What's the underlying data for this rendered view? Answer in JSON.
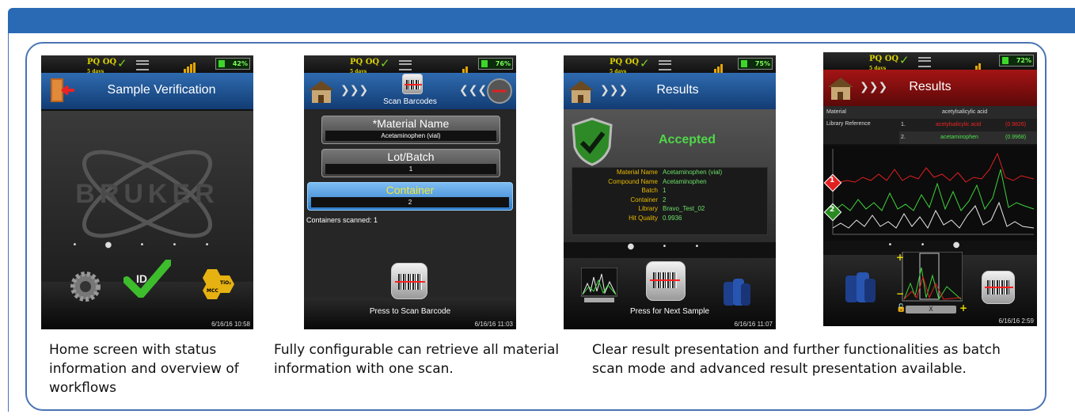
{
  "colors": {
    "header_blue": "#2a6ab5",
    "frame_border": "#4a74b4",
    "accent_green": "#6ce06a",
    "accent_yellow": "#e8b900",
    "results_red": "#a41414"
  },
  "screens": [
    {
      "id": "home",
      "battery": "42%",
      "title": "Sample Verification",
      "watermark": "BRUKER",
      "page_indicator": "• ● • • •",
      "bottom_icons": [
        "gear-icon",
        "id-check-icon",
        "tools-chemistry-icon"
      ],
      "id_text": "ID",
      "hex_text_1": "TiO₂",
      "hex_text_2": "MCC",
      "timestamp": "6/16/16 10:58"
    },
    {
      "id": "scan",
      "battery": "76%",
      "subtitle": "Scan Barcodes",
      "fields": [
        {
          "label": "*Material Name",
          "value": "Acetaminophen (vial)"
        },
        {
          "label": "Lot/Batch",
          "value": "1"
        },
        {
          "label": "Container",
          "value": "2"
        }
      ],
      "status": "Containers scanned: 1",
      "button_label": "Press to Scan Barcode",
      "timestamp": "6/16/16 11:03"
    },
    {
      "id": "results",
      "battery": "75%",
      "title": "Results",
      "verdict": "Accepted",
      "rows": [
        {
          "k": "Material Name",
          "v": "Acetaminophen (vial)"
        },
        {
          "k": "Compound Name",
          "v": "Acetaminophen"
        },
        {
          "k": "Batch",
          "v": "1"
        },
        {
          "k": "Container",
          "v": "2"
        },
        {
          "k": "Library",
          "v": "Bravo_Test_02"
        },
        {
          "k": "Hit Quality",
          "v": "0.9936"
        }
      ],
      "page_indicator": "● • •",
      "button_label": "Press for Next Sample",
      "timestamp": "6/16/16 11:07"
    },
    {
      "id": "results_spectra",
      "battery": "72%",
      "title": "Results",
      "material_label": "Material",
      "material_value": "acetylsalicylic acid",
      "library_label": "Library Reference",
      "hits": [
        {
          "rank": "1.",
          "name": "acetylsalicylic acid",
          "score": "(0.9826)"
        },
        {
          "rank": "2.",
          "name": "acetaminophen",
          "score": "(0.9968)"
        }
      ],
      "marker_1": "1",
      "marker_2": "2",
      "page_indicator": "• • ●",
      "zoom_plus": "+",
      "zoom_minus": "−",
      "zoom_x": "X",
      "timestamp": "6/16/16 2:59"
    }
  ],
  "captions": [
    "Home screen with status information and overview of workflows",
    "Fully configurable can retrieve all material information with one scan.",
    "Clear result presentation and further functionalities as batch scan mode and advanced result presentation available."
  ]
}
